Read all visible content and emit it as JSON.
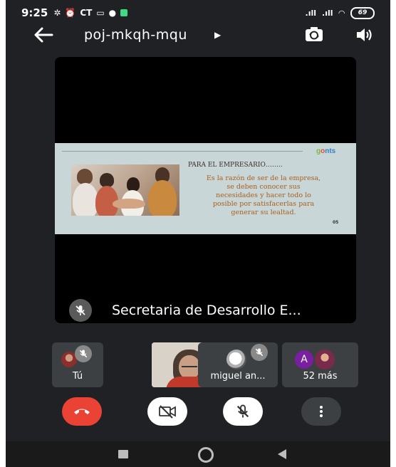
{
  "status_bar": {
    "time": "9:25",
    "carrier_tag": "CT",
    "battery": "69"
  },
  "top_bar": {
    "meeting_code": "poj-mkqh-mqu"
  },
  "main_tile": {
    "slide": {
      "logo": [
        "g",
        "o",
        "nts"
      ],
      "heading": "PARA EL EMPRESARIO……..",
      "body": "Es la razón de ser de la empresa, se deben conocer sus necesidades y hacer todo lo posible por satisfacerlas para generar su lealtad.",
      "note": "05"
    },
    "participant_name": "Secretaria de Desarrollo E..."
  },
  "participants": {
    "self_label": "Tú",
    "miguel_label": "miguel an...",
    "more_avatar_letter": "A",
    "more_label": "52 más"
  },
  "colors": {
    "end_call": "#ea4335",
    "background": "#202124",
    "tile": "#3c4043",
    "avatar_purple": "#7b1fa2"
  }
}
